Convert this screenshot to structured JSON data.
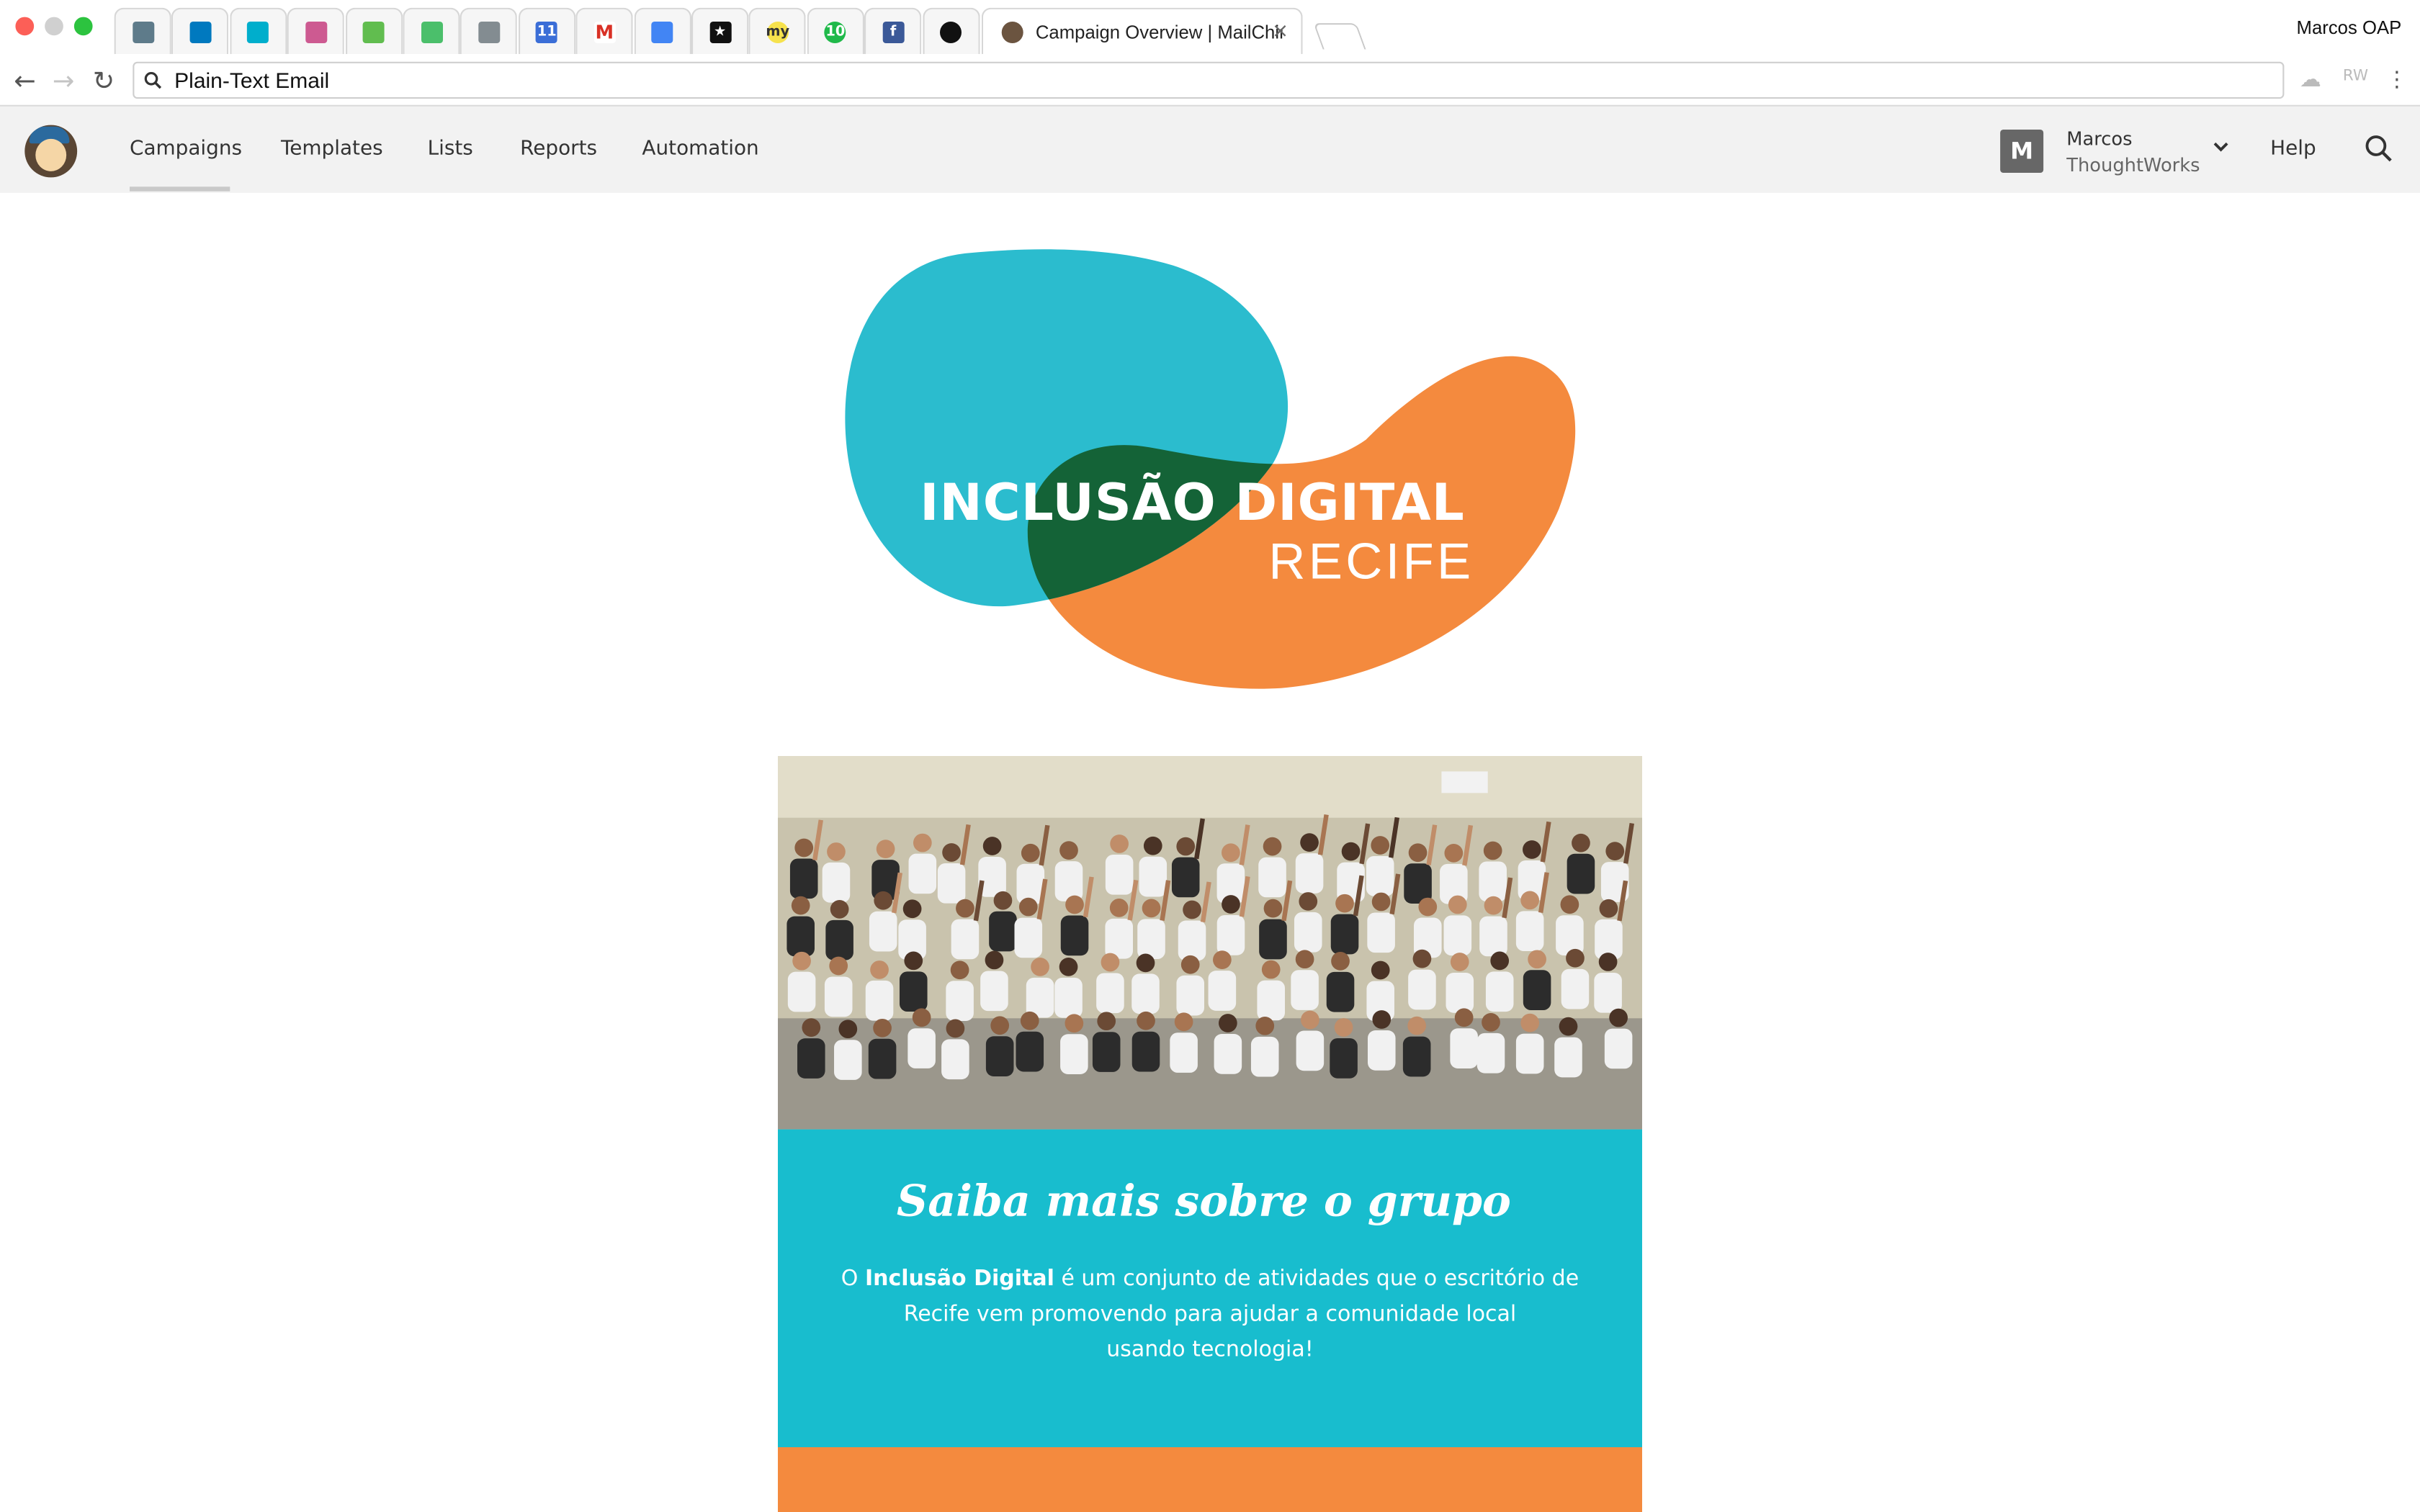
{
  "browser": {
    "active_tab_title": "Campaign Overview | MailChimp",
    "tab_close": "×",
    "profile": "Marcos OAP",
    "address": "Plain-Text Email",
    "pinned_tabs": [
      {
        "icon": "trello-board-icon",
        "color": "#5e7b8a",
        "glyph": ""
      },
      {
        "icon": "trello-icon",
        "color": "#0079bf",
        "glyph": ""
      },
      {
        "icon": "trello-icon",
        "color": "#00aecc",
        "glyph": ""
      },
      {
        "icon": "trello-icon",
        "color": "#cd5a91",
        "glyph": ""
      },
      {
        "icon": "trello-icon",
        "color": "#61bd4f",
        "glyph": ""
      },
      {
        "icon": "trello-icon",
        "color": "#4bbf6b",
        "glyph": ""
      },
      {
        "icon": "trello-icon",
        "color": "#838c91",
        "glyph": ""
      },
      {
        "icon": "calendar-icon",
        "color": "#3b6ed7",
        "glyph": "11"
      },
      {
        "icon": "gmail-icon",
        "color": "#ffffff",
        "glyph": "M"
      },
      {
        "icon": "inbox-icon",
        "color": "#4285f4",
        "glyph": ""
      },
      {
        "icon": "star-app-icon",
        "color": "#111111",
        "glyph": "★"
      },
      {
        "icon": "my-app-icon",
        "color": "#f6e24d",
        "glyph": "my"
      },
      {
        "icon": "counter-badge-icon",
        "color": "#20b94a",
        "glyph": "10"
      },
      {
        "icon": "facebook-icon",
        "color": "#3b5998",
        "glyph": "f"
      },
      {
        "icon": "github-icon",
        "color": "#111111",
        "glyph": "●"
      }
    ]
  },
  "mailchimp": {
    "nav": [
      "Campaigns",
      "Templates",
      "Lists",
      "Reports",
      "Automation"
    ],
    "user": {
      "initial": "M",
      "name": "Marcos",
      "org": "ThoughtWorks"
    },
    "help": "Help"
  },
  "email": {
    "hero_title": "INCLUSÃO DIGITAL",
    "hero_subtitle": "RECIFE",
    "section_title": "Saiba mais sobre o grupo",
    "body_prefix": "O ",
    "body_bold": "Inclusão Digital",
    "body_line1_rest": " é um conjunto de atividades que o escritório de",
    "body_line2": "Recife vem promovendo para ajudar a comunidade local",
    "body_line3": "usando tecnologia!"
  },
  "colors": {
    "teal": "#18bdce",
    "blob_blue": "#2bbcce",
    "blob_green": "#146337",
    "blob_orange": "#f48a3e"
  }
}
